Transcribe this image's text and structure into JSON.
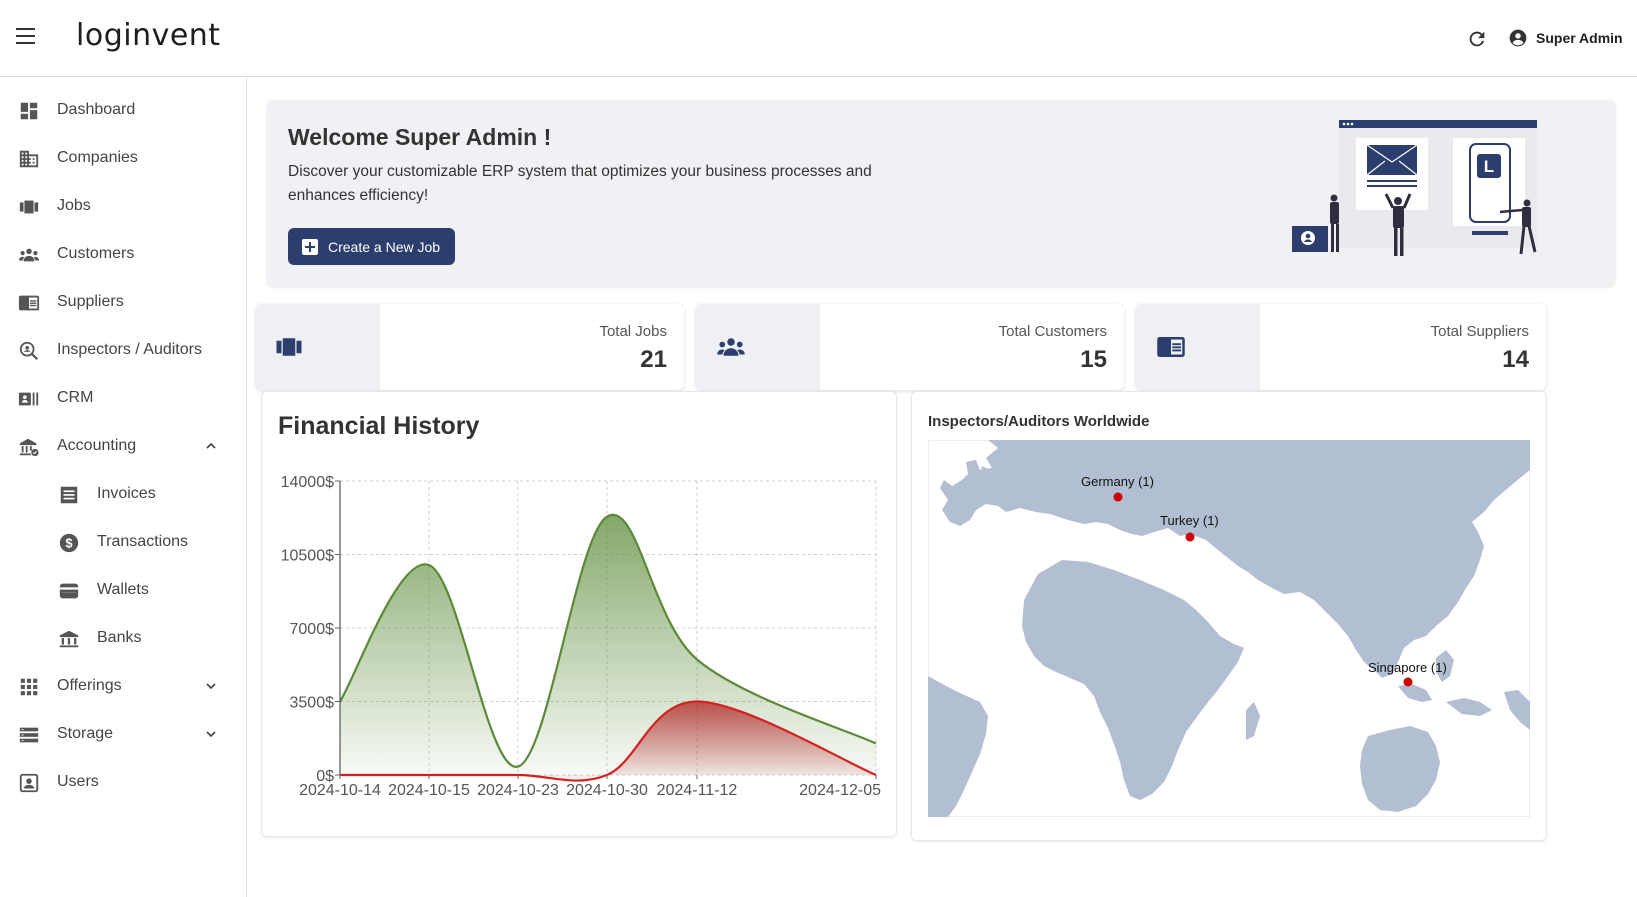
{
  "app": {
    "logo": "loginvent",
    "user_name": "Super Admin"
  },
  "sidebar": {
    "items": [
      {
        "label": "Dashboard",
        "icon": "dashboard-icon"
      },
      {
        "label": "Companies",
        "icon": "building-icon"
      },
      {
        "label": "Jobs",
        "icon": "jobs-icon"
      },
      {
        "label": "Customers",
        "icon": "customers-icon"
      },
      {
        "label": "Suppliers",
        "icon": "suppliers-icon"
      },
      {
        "label": "Inspectors / Auditors",
        "icon": "inspector-icon"
      },
      {
        "label": "CRM",
        "icon": "crm-icon"
      },
      {
        "label": "Accounting",
        "icon": "accounting-icon",
        "expanded": true
      },
      {
        "label": "Invoices",
        "icon": "invoice-icon"
      },
      {
        "label": "Transactions",
        "icon": "dollar-icon"
      },
      {
        "label": "Wallets",
        "icon": "wallet-icon"
      },
      {
        "label": "Banks",
        "icon": "bank-icon"
      },
      {
        "label": "Offerings",
        "icon": "grid-icon",
        "expanded": false
      },
      {
        "label": "Storage",
        "icon": "storage-icon",
        "expanded": false
      },
      {
        "label": "Users",
        "icon": "user-icon"
      }
    ]
  },
  "welcome": {
    "title": "Welcome Super Admin !",
    "text": "Discover your customizable ERP system that optimizes your business processes and enhances efficiency!",
    "button_label": "Create a New Job"
  },
  "stats": [
    {
      "label": "Total Jobs",
      "value": "21",
      "icon": "jobs-icon"
    },
    {
      "label": "Total Customers",
      "value": "15",
      "icon": "customers-icon"
    },
    {
      "label": "Total Suppliers",
      "value": "14",
      "icon": "suppliers-icon"
    }
  ],
  "financial": {
    "title": "Financial History"
  },
  "map": {
    "title": "Inspectors/Auditors Worldwide",
    "markers": [
      {
        "label": "Germany (1)"
      },
      {
        "label": "Turkey (1)"
      },
      {
        "label": "Singapore (1)"
      }
    ]
  },
  "colors": {
    "primary": "#2b3e6e",
    "series_green": "#5a8a37",
    "series_red": "#d42020",
    "map_land": "#b2bed2",
    "marker": "#d00000"
  },
  "chart_data": {
    "type": "area",
    "categories": [
      "2024-10-14",
      "2024-10-15",
      "2024-10-23",
      "2024-10-30",
      "2024-11-12",
      "2024-12-05"
    ],
    "tick_labels": [
      "2024-10-14",
      "2024-10-15",
      "2024-10-23",
      "2024-10-30",
      "2024-11-12",
      "2024-12-05"
    ],
    "y_tick_labels": [
      "0$",
      "3500$",
      "7000$",
      "10500$",
      "14000$"
    ],
    "ylim": [
      0,
      14000
    ],
    "series": [
      {
        "values": [
          3500,
          10000,
          400,
          12300,
          5500,
          1500
        ],
        "color": "#5a8a37"
      },
      {
        "values": [
          0,
          0,
          0,
          0,
          3500,
          0
        ],
        "color": "#d42020"
      }
    ],
    "grid": true,
    "title": "",
    "xlabel": "",
    "ylabel": ""
  }
}
